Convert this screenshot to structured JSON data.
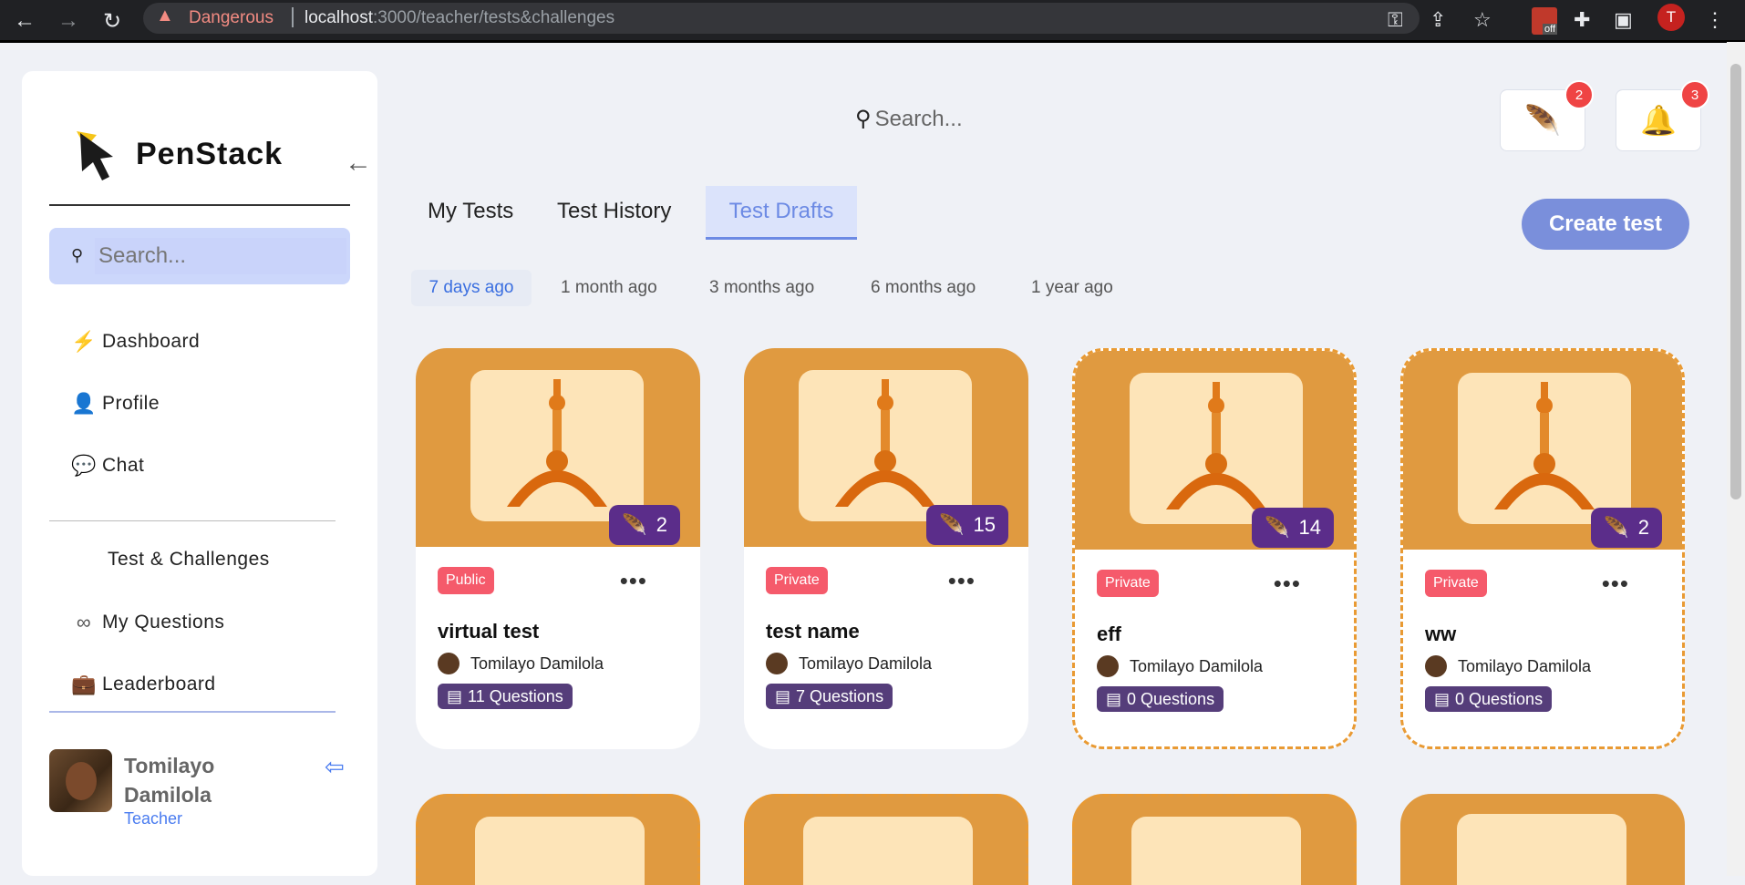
{
  "browser": {
    "security_label": "Dangerous",
    "url_host": "localhost",
    "url_rest": ":3000/teacher/tests&challenges",
    "profile_initial": "T",
    "ext_badge": "off"
  },
  "sidebar": {
    "brand": "PenStack",
    "search_placeholder": "Search...",
    "items": [
      {
        "label": "Dashboard",
        "icon": "bolt-icon"
      },
      {
        "label": "Profile",
        "icon": "user-icon"
      },
      {
        "label": "Chat",
        "icon": "chat-icon"
      },
      {
        "label": "Test & Challenges",
        "icon": ""
      },
      {
        "label": "My Questions",
        "icon": "infinity-icon"
      },
      {
        "label": "Leaderboard",
        "icon": "briefcase-icon"
      }
    ],
    "user": {
      "name": "Tomilayo Damilola",
      "role": "Teacher"
    }
  },
  "header": {
    "search_placeholder": "Search...",
    "feather_badge": "2",
    "bell_badge": "3"
  },
  "tabs": [
    "My Tests",
    "Test History",
    "Test Drafts"
  ],
  "create_label": "Create test",
  "time_filters": [
    "7 days ago",
    "1 month ago",
    "3 months ago",
    "6 months ago",
    "1 year ago"
  ],
  "cards": [
    {
      "count": "2",
      "visibility": "Public",
      "title": "virtual test",
      "author": "Tomilayo Damilola",
      "questions": "11 Questions"
    },
    {
      "count": "15",
      "visibility": "Private",
      "title": "test name",
      "author": "Tomilayo Damilola",
      "questions": "7 Questions"
    },
    {
      "count": "14",
      "visibility": "Private",
      "title": "eff",
      "author": "Tomilayo Damilola",
      "questions": "0 Questions"
    },
    {
      "count": "2",
      "visibility": "Private",
      "title": "ww",
      "author": "Tomilayo Damilola",
      "questions": "0 Questions"
    }
  ],
  "colors": {
    "accent": "#6c8ae4",
    "card_top": "#e09a40",
    "count_badge": "#5b2d8a",
    "visibility_badge": "#f55a6b"
  }
}
